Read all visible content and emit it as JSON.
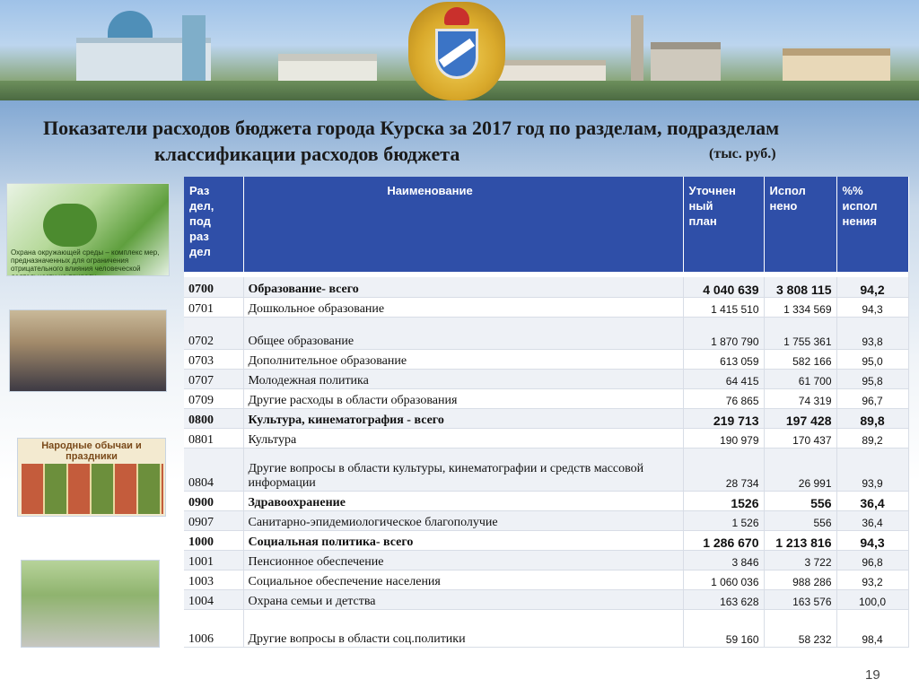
{
  "title": {
    "line1": "Показатели расходов бюджета города Курска за 2017 год по разделам, подразделам",
    "line2": "классификации расходов бюджета",
    "units": "(тыс. руб.)"
  },
  "table": {
    "headers": {
      "code": [
        "Раз",
        "дел,",
        "под",
        "раз",
        "дел"
      ],
      "name": "Наименование",
      "plan": [
        "Уточнен",
        "ный",
        "план"
      ],
      "done": [
        "Испол",
        "нено"
      ],
      "pct": [
        "%%",
        "испол",
        "нения"
      ]
    },
    "rows": [
      {
        "code": "0700",
        "name": "Образование- всего",
        "plan": "4 040 639",
        "done": "3 808 115",
        "pct": "94,2",
        "bold": true
      },
      {
        "code": "0701",
        "name": "Дошкольное образование",
        "plan": "1 415 510",
        "done": "1 334 569",
        "pct": "94,3"
      },
      {
        "code": "0702",
        "name": "Общее образование",
        "plan": "1 870 790",
        "done": "1 755 361",
        "pct": "93,8",
        "tall": true
      },
      {
        "code": "0703",
        "name": "Дополнительное образование",
        "plan": "613 059",
        "done": "582 166",
        "pct": "95,0"
      },
      {
        "code": "0707",
        "name": "Молодежная политика",
        "plan": "64 415",
        "done": "61 700",
        "pct": "95,8"
      },
      {
        "code": "0709",
        "name": "Другие расходы в области образования",
        "plan": "76 865",
        "done": "74 319",
        "pct": "96,7"
      },
      {
        "code": "0800",
        "name": "Культура,  кинематография  - всего",
        "plan": "219 713",
        "done": "197 428",
        "pct": "89,8",
        "bold": true
      },
      {
        "code": "0801",
        "name": "Культура",
        "plan": "190 979",
        "done": "170 437",
        "pct": "89,2"
      },
      {
        "code": "0804",
        "name": "Другие вопросы в области культуры, кинематографии и средств массовой информации",
        "plan": "28 734",
        "done": "26 991",
        "pct": "93,9",
        "tall": true
      },
      {
        "code": "0900",
        "name": "Здравоохранение",
        "plan": "1526",
        "done": "556",
        "pct": "36,4",
        "bold": true
      },
      {
        "code": "0907",
        "name": "Санитарно-эпидемиологическое благополучие",
        "plan": "1 526",
        "done": "556",
        "pct": "36,4"
      },
      {
        "code": "1000",
        "name": "Социальная политика- всего",
        "plan": "1 286 670",
        "done": "1 213 816",
        "pct": "94,3",
        "bold": true
      },
      {
        "code": "1001",
        "name": "Пенсионное обеспечение",
        "plan": "3 846",
        "done": "3 722",
        "pct": "96,8"
      },
      {
        "code": "1003",
        "name": "Социальное обеспечение населения",
        "plan": "1 060 036",
        "done": "988 286",
        "pct": "93,2"
      },
      {
        "code": "1004",
        "name": "Охрана семьи и детства",
        "plan": "163 628",
        "done": "163 576",
        "pct": "100,0"
      },
      {
        "code": "1006",
        "name": "Другие вопросы в области соц.политики",
        "plan": "59 160",
        "done": "58 232",
        "pct": "98,4",
        "xtall": true
      }
    ]
  },
  "photos": {
    "p1_caption": "Охрана окружающей среды – комплекс мер, предназначенных для ограничения отрицательного влияния человеческой деятельности на природу",
    "p3_heading": "Народные обычаи и праздники"
  },
  "page_number": "19"
}
